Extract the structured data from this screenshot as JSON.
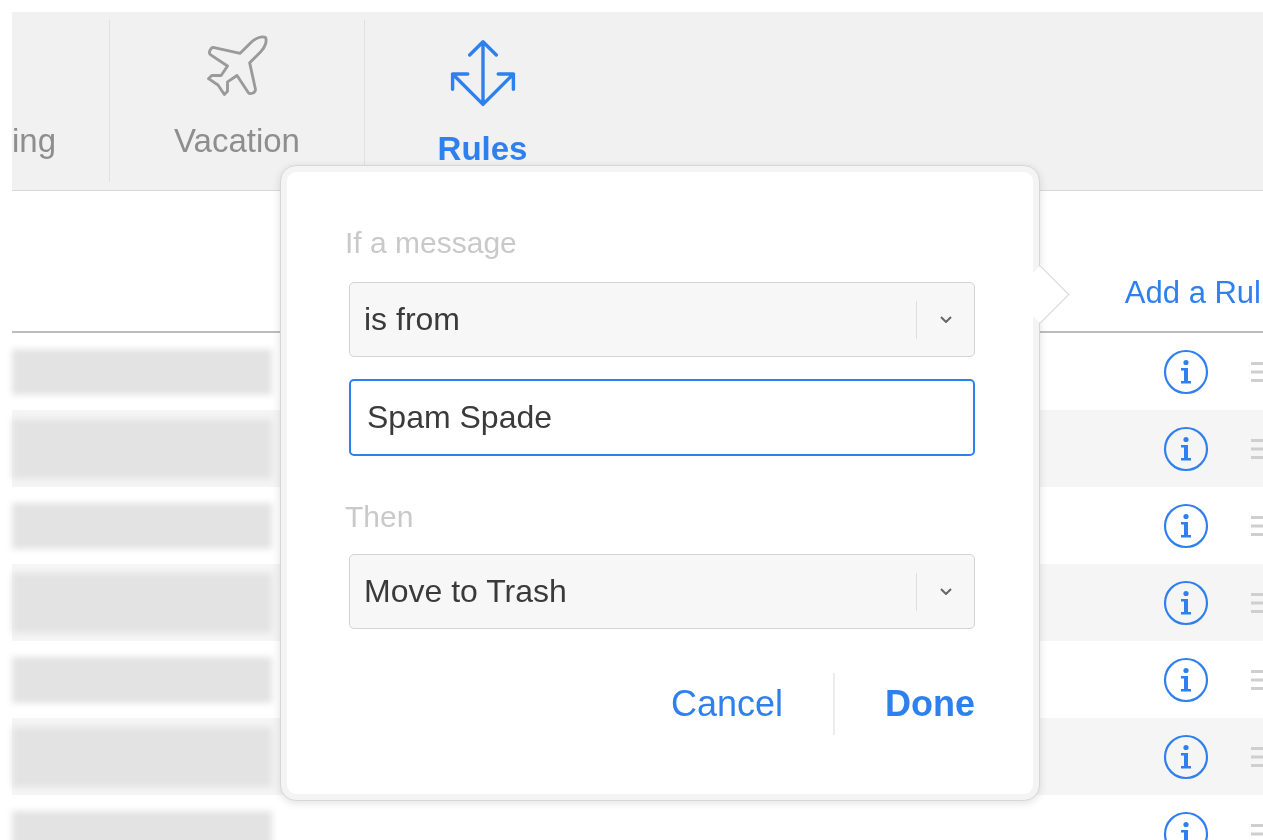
{
  "toolbar": {
    "tabs": [
      {
        "label": "ing",
        "selected": false
      },
      {
        "label": "Vacation",
        "selected": false
      },
      {
        "label": "Rules",
        "selected": true
      }
    ]
  },
  "add_rule_link": "Add a Rul",
  "rules": [
    {
      "striped": false
    },
    {
      "striped": true
    },
    {
      "striped": false
    },
    {
      "striped": true
    },
    {
      "striped": false
    },
    {
      "striped": true
    },
    {
      "striped": false
    }
  ],
  "popover": {
    "condition_label": "If a message",
    "condition": "is from",
    "value": "Spam Spade",
    "action_label": "Then",
    "action": "Move to Trash",
    "buttons": [
      {
        "label": "Cancel",
        "primary": false
      },
      {
        "label": "Done",
        "primary": true
      }
    ]
  }
}
